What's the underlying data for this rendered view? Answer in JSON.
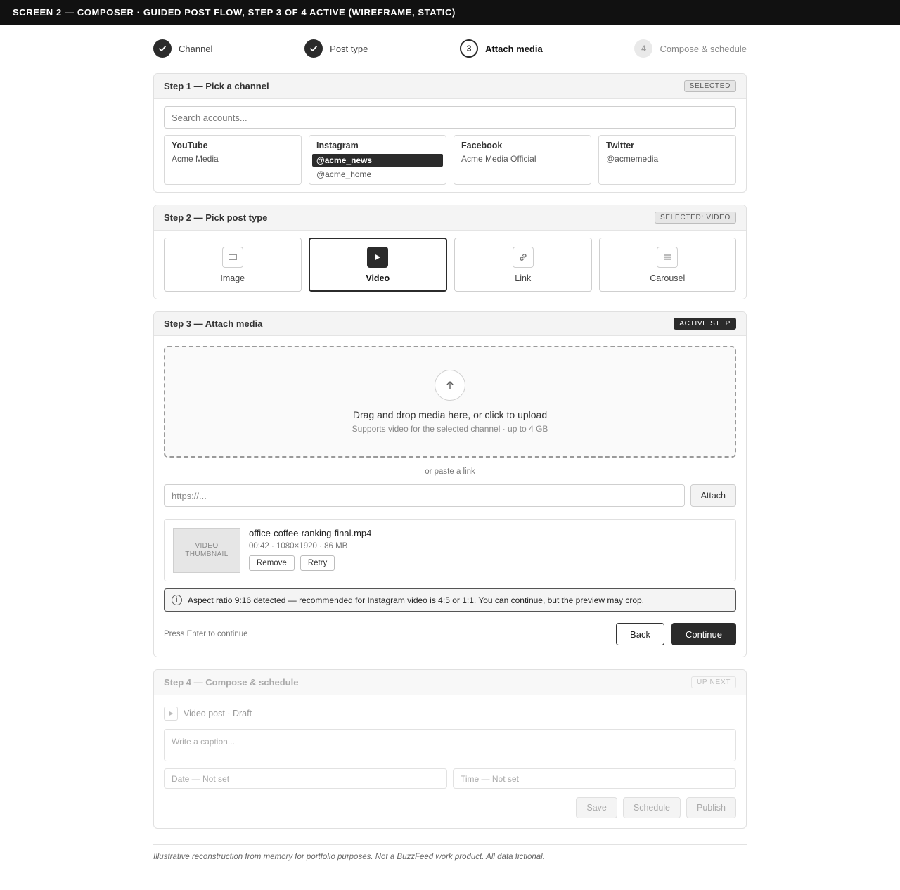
{
  "topbar": {
    "title": "SCREEN 2 — COMPOSER · GUIDED POST FLOW, STEP 3 OF 4 ACTIVE (WIREFRAME, STATIC)"
  },
  "stepper": {
    "steps": [
      {
        "label": "Channel",
        "state": "done"
      },
      {
        "label": "Post type",
        "state": "done"
      },
      {
        "number": "3",
        "label": "Attach media",
        "state": "active"
      },
      {
        "number": "4",
        "label": "Compose & schedule",
        "state": "future"
      }
    ]
  },
  "step1": {
    "title": "Step 1 — Pick a channel",
    "badge": "SELECTED",
    "search_placeholder": "Search accounts...",
    "channels": [
      {
        "name": "YouTube",
        "accounts": [
          "Acme Media"
        ]
      },
      {
        "name": "Instagram",
        "accounts": [
          "@acme_news",
          "@acme_home"
        ],
        "selected": "@acme_news"
      },
      {
        "name": "Facebook",
        "accounts": [
          "Acme Media Official"
        ]
      },
      {
        "name": "Twitter",
        "accounts": [
          "@acmemedia"
        ]
      }
    ]
  },
  "step2": {
    "title": "Step 2 — Pick post type",
    "badge": "SELECTED: VIDEO",
    "types": [
      {
        "label": "Image",
        "icon": "image-icon"
      },
      {
        "label": "Video",
        "icon": "play-icon",
        "selected": true
      },
      {
        "label": "Link",
        "icon": "link-icon"
      },
      {
        "label": "Carousel",
        "icon": "carousel-icon"
      }
    ]
  },
  "step3": {
    "title": "Step 3 — Attach media",
    "badge": "ACTIVE STEP",
    "drop_main": "Drag and drop media here, or click to upload",
    "drop_sub": "Supports video for the selected channel · up to 4 GB",
    "divider": "or paste a link",
    "link_placeholder": "https://...",
    "attach_label": "Attach",
    "file": {
      "thumb_label": "VIDEO THUMBNAIL",
      "name": "office-coffee-ranking-final.mp4",
      "meta": "00:42 · 1080×1920 · 86 MB",
      "remove_label": "Remove",
      "retry_label": "Retry"
    },
    "warning": "Aspect ratio 9:16 detected — recommended for Instagram video is 4:5 or 1:1. You can continue, but the preview may crop.",
    "hint": "Press Enter to continue",
    "back_label": "Back",
    "continue_label": "Continue"
  },
  "step4": {
    "title": "Step 4 — Compose & schedule",
    "badge": "UP NEXT",
    "post_type": "Video post · Draft",
    "caption_placeholder": "Write a caption...",
    "date_placeholder": "Date — Not set",
    "time_placeholder": "Time — Not set",
    "save_label": "Save",
    "schedule_label": "Schedule",
    "publish_label": "Publish"
  },
  "disclaimer": "Illustrative reconstruction from memory for portfolio purposes. Not a BuzzFeed work product. All data fictional."
}
